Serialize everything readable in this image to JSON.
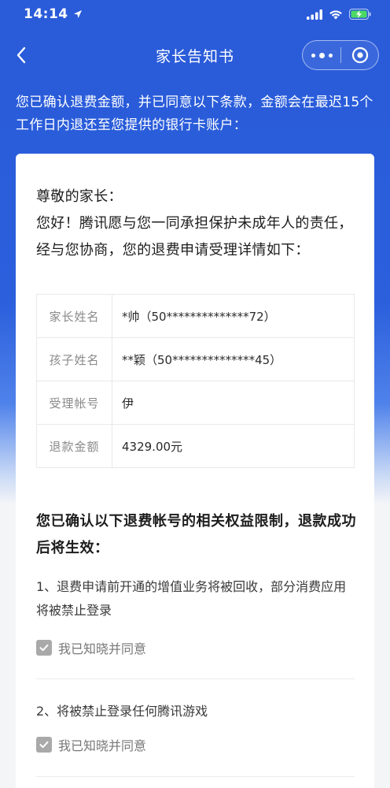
{
  "status_bar": {
    "time": "14:14",
    "icons": [
      "location-arrow-icon",
      "cellular-signal-icon",
      "wifi-icon",
      "battery-charging-icon"
    ]
  },
  "nav": {
    "title": "家长告知书",
    "back_icon": "chevron-left-icon",
    "more_icon": "more-dots-icon",
    "close_icon": "target-close-icon"
  },
  "intro": "您已确认退费金额，并已同意以下条款，金额会在最迟15个工作日内退还至您提供的银行卡账户：",
  "letter": {
    "salutation": "尊敬的家长：",
    "body": "您好！腾讯愿与您一同承担保护未成年人的责任，经与您协商，您的退费申请受理详情如下："
  },
  "details": [
    {
      "label": "家长姓名",
      "value": "*帅（50**************72）"
    },
    {
      "label": "孩子姓名",
      "value": "**颖（50**************45）"
    },
    {
      "label": "受理帐号",
      "value": "伊"
    },
    {
      "label": "退款金额",
      "value": "4329.00元"
    }
  ],
  "restrictions": {
    "title": "您已确认以下退费帐号的相关权益限制，退款成功后将生效：",
    "items": [
      {
        "text": "1、退费申请前开通的增值业务将被回收，部分消费应用将被禁止登录",
        "agree_label": "我已知晓并同意",
        "checked": true
      },
      {
        "text": "2、将被禁止登录任何腾讯游戏",
        "agree_label": "我已知晓并同意",
        "checked": true
      }
    ]
  },
  "colors": {
    "header_blue": "#2b5fdc",
    "card_bg": "#ffffff",
    "checkbox_gray": "#a9a9a9"
  }
}
